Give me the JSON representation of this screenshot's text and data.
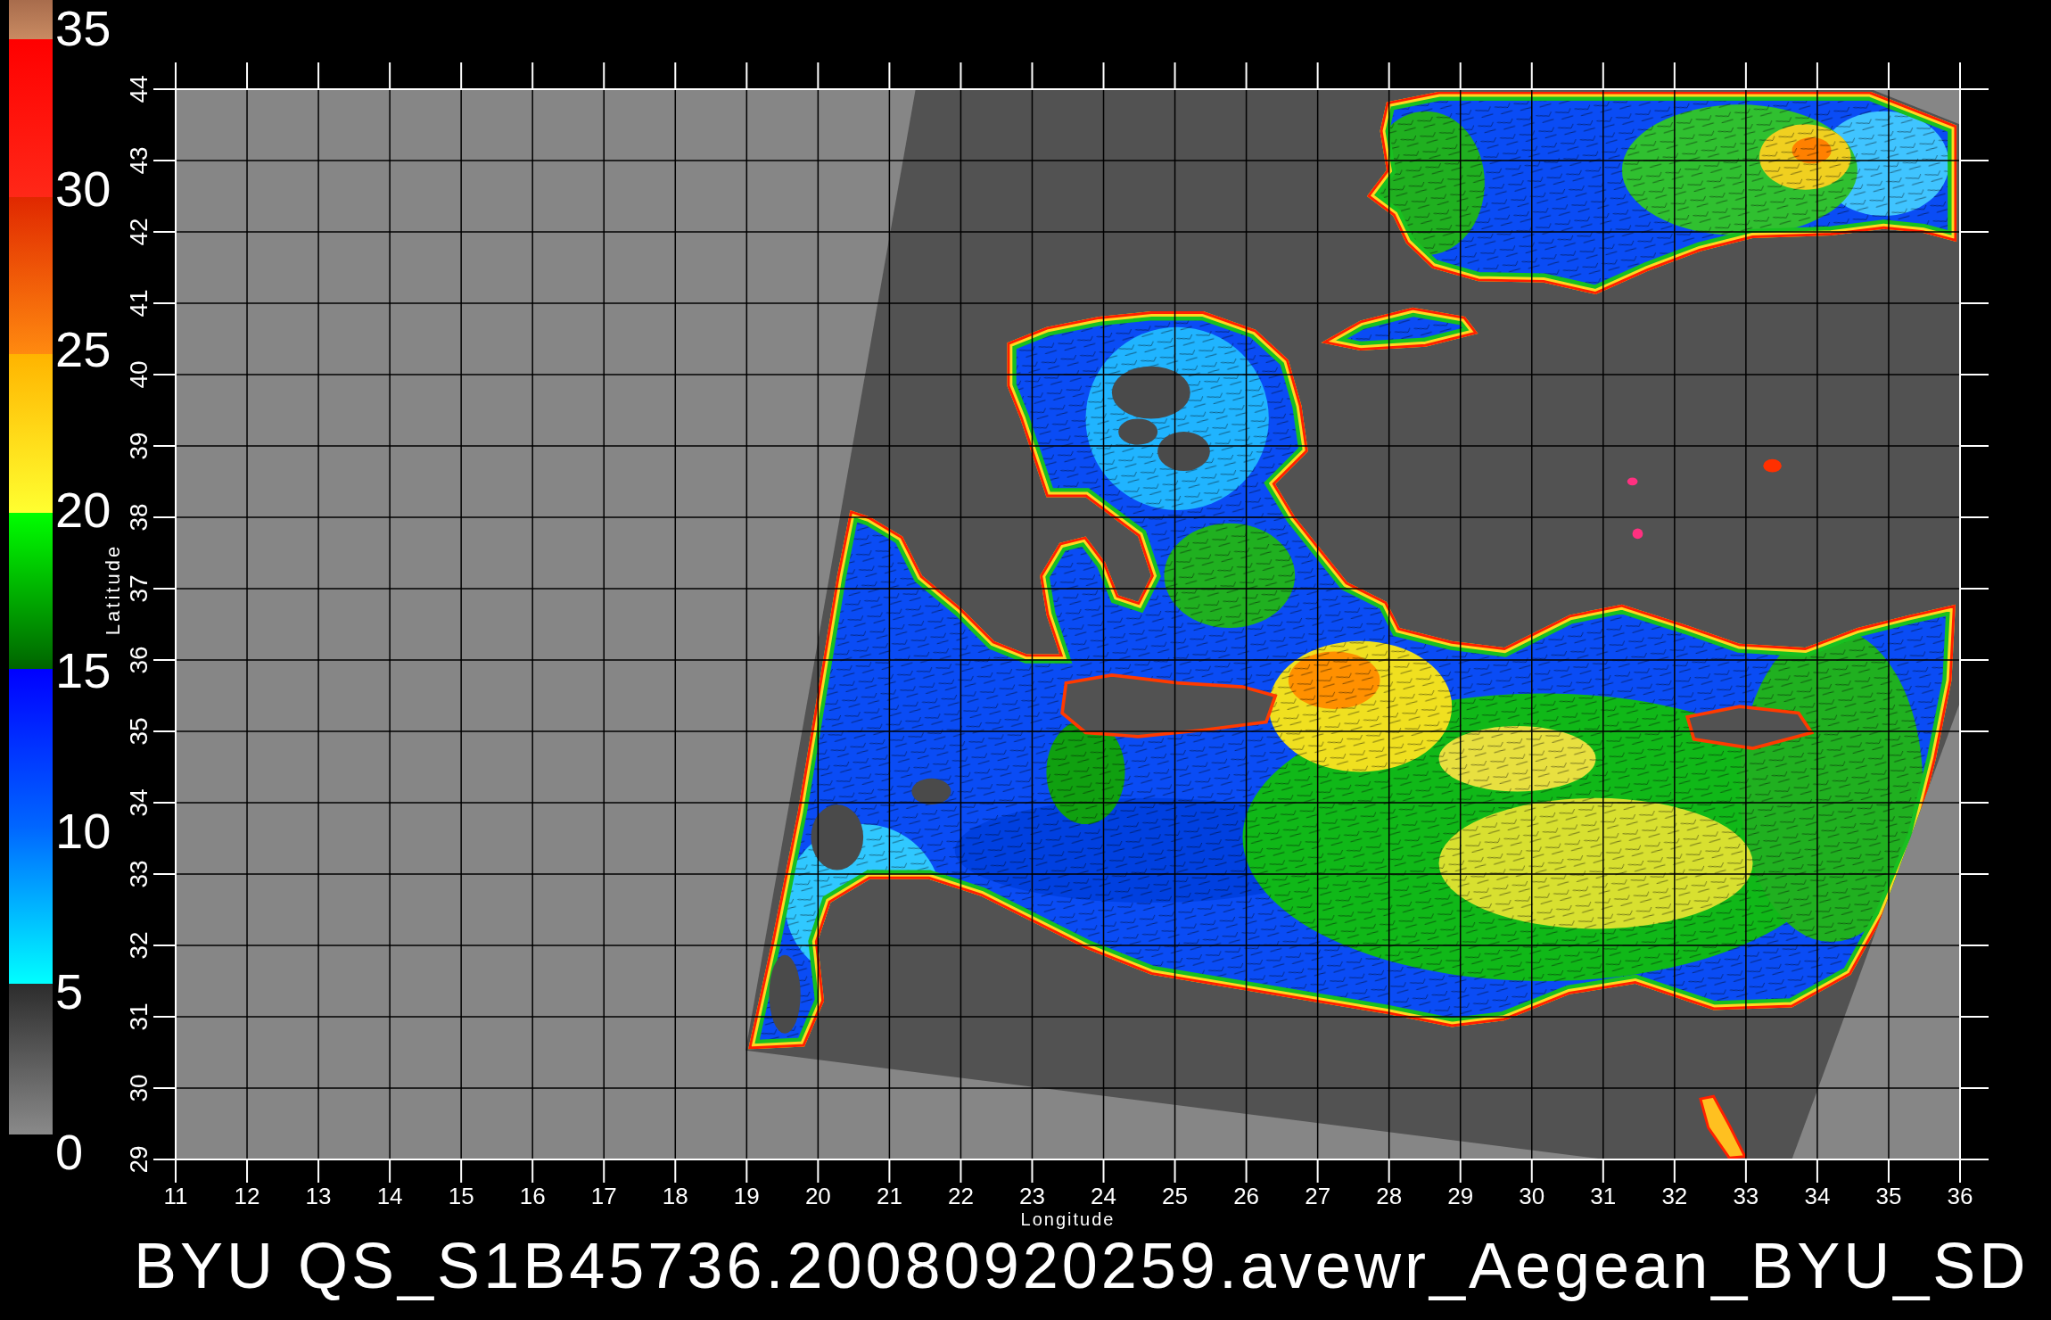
{
  "colorbar": {
    "ticks": [
      "35",
      "30",
      "25",
      "20",
      "15",
      "10",
      "5",
      "0"
    ]
  },
  "plot": {
    "yticks": [
      "44",
      "43",
      "42",
      "41",
      "40",
      "39",
      "38",
      "37",
      "36",
      "35",
      "34",
      "33",
      "32",
      "31",
      "30",
      "29"
    ],
    "ylabel": "Latitude",
    "xticks": [
      "11",
      "12",
      "13",
      "14",
      "15",
      "16",
      "17",
      "18",
      "19",
      "20",
      "21",
      "22",
      "23",
      "24",
      "25",
      "26",
      "27",
      "28",
      "29",
      "30",
      "31",
      "32",
      "33",
      "34",
      "35",
      "36"
    ],
    "xlabel": "Longitude"
  },
  "title": "BYU QS_S1B45736.20080920259.avewr_Aegean_BYU_SD"
}
